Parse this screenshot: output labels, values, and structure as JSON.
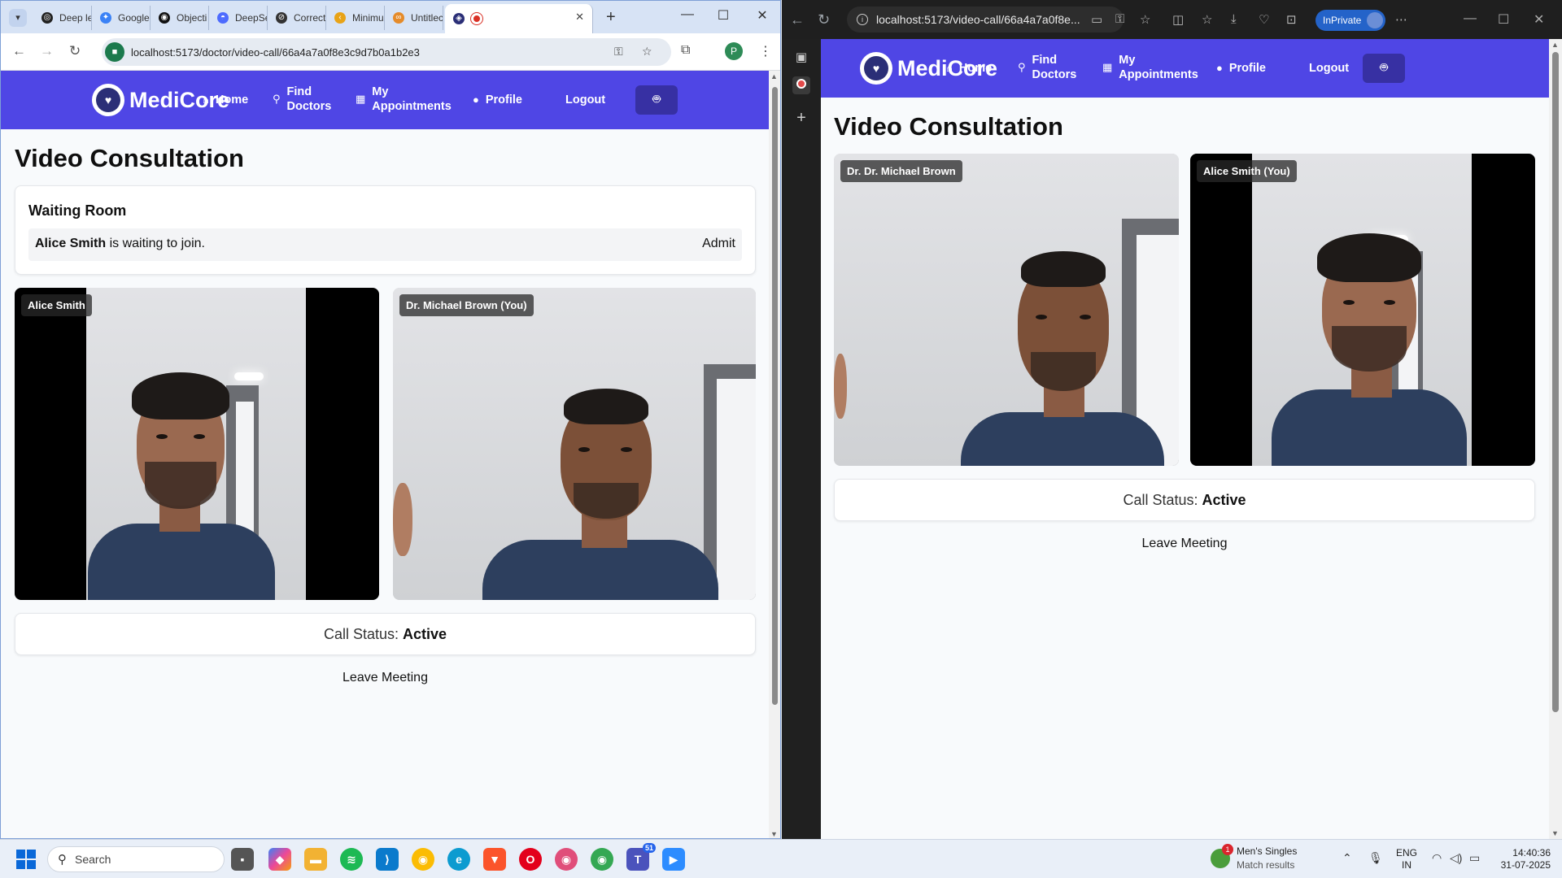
{
  "chrome": {
    "tabs": [
      {
        "label": "Deep le",
        "icon": "openai-icon",
        "color": "#222222"
      },
      {
        "label": "Google",
        "icon": "gemini-icon",
        "color": "#3b82f6"
      },
      {
        "label": "Objecti",
        "icon": "github-icon",
        "color": "#111111"
      },
      {
        "label": "DeepSe",
        "icon": "deepseek-icon",
        "color": "#4d6bfe"
      },
      {
        "label": "Correct",
        "icon": "perplexity-icon",
        "color": "#333333"
      },
      {
        "label": "Minimu",
        "icon": "leetcode-icon",
        "color": "#e8a317"
      },
      {
        "label": "Untitlec",
        "icon": "infinity-icon",
        "color": "#e58b2a"
      }
    ],
    "url": "localhost:5173/doctor/video-call/66a4a7a0f8e3c9d7b0a1b2e3",
    "profile_initial": "P"
  },
  "app": {
    "brand": "MediCore",
    "nav": {
      "home": "Home",
      "find_doctors_1": "Find",
      "find_doctors_2": "Doctors",
      "appointments_1": "My",
      "appointments_2": "Appointments",
      "profile": "Profile",
      "logout": "Logout"
    },
    "title": "Video Consultation",
    "call_status_label": "Call Status:",
    "call_status_value": "Active",
    "leave": "Leave Meeting"
  },
  "doctor_view": {
    "waiting_room_title": "Waiting Room",
    "waiting_patient": "Alice Smith",
    "waiting_text": " is waiting to join.",
    "admit": "Admit",
    "remote_label": "Alice Smith",
    "local_label": "Dr. Michael Brown (You)"
  },
  "patient_view": {
    "url": "localhost:5173/video-call/66a4a7a0f8e...",
    "inprivate": "InPrivate",
    "remote_label": "Dr. Dr. Michael Brown",
    "local_label": "Alice Smith (You)"
  },
  "taskbar": {
    "search": "Search",
    "widget_title": "Men's Singles",
    "widget_sub": "Match results",
    "widget_badge": "1",
    "teams_badge": "51",
    "lang_1": "ENG",
    "lang_2": "IN",
    "time": "14:40:36",
    "date": "31-07-2025"
  }
}
